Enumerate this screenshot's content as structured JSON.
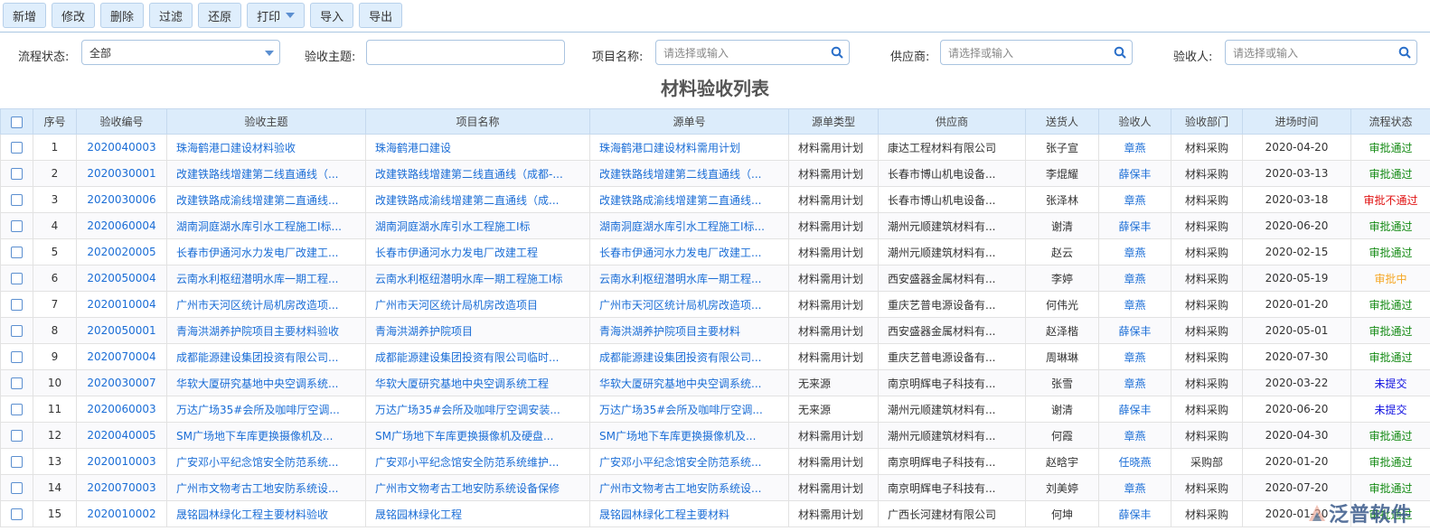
{
  "toolbar": {
    "buttons": [
      "新增",
      "修改",
      "删除",
      "过滤",
      "还原",
      "打印",
      "导入",
      "导出"
    ]
  },
  "filters": {
    "status_label": "流程状态:",
    "status_value": "全部",
    "subject_label": "验收主题:",
    "subject_value": "",
    "project_label": "项目名称:",
    "project_placeholder": "请选择或输入",
    "supplier_label": "供应商:",
    "supplier_placeholder": "请选择或输入",
    "receiver_label": "验收人:",
    "receiver_placeholder": "请选择或输入"
  },
  "page_title": "材料验收列表",
  "columns": [
    "序号",
    "验收编号",
    "验收主题",
    "项目名称",
    "源单号",
    "源单类型",
    "供应商",
    "送货人",
    "验收人",
    "验收部门",
    "进场时间",
    "流程状态"
  ],
  "status_colors": {
    "审批通过": "#138a13",
    "审批不通过": "#e01010",
    "审批中": "#f5a623",
    "未提交": "#1010e0"
  },
  "rows": [
    [
      "1",
      "2020040003",
      "珠海鹤港口建设材料验收",
      "珠海鹤港口建设",
      "珠海鹤港口建设材料需用计划",
      "材料需用计划",
      "康达工程材料有限公司",
      "张子宣",
      "章燕",
      "材料采购",
      "2020-04-20",
      "审批通过"
    ],
    [
      "2",
      "2020030001",
      "改建铁路线增建第二线直通线（...",
      "改建铁路线增建第二线直通线（成都-...",
      "改建铁路线增建第二线直通线（...",
      "材料需用计划",
      "长春市博山机电设备...",
      "李焜耀",
      "薛保丰",
      "材料采购",
      "2020-03-13",
      "审批通过"
    ],
    [
      "3",
      "2020030006",
      "改建铁路成渝线增建第二直通线...",
      "改建铁路成渝线增建第二直通线（成...",
      "改建铁路成渝线增建第二直通线...",
      "材料需用计划",
      "长春市博山机电设备...",
      "张泽林",
      "章燕",
      "材料采购",
      "2020-03-18",
      "审批不通过"
    ],
    [
      "4",
      "2020060004",
      "湖南洞庭湖水库引水工程施工I标...",
      "湖南洞庭湖水库引水工程施工I标",
      "湖南洞庭湖水库引水工程施工I标...",
      "材料需用计划",
      "潮州元顺建筑材料有...",
      "谢清",
      "薛保丰",
      "材料采购",
      "2020-06-20",
      "审批通过"
    ],
    [
      "5",
      "2020020005",
      "长春市伊通河水力发电厂改建工...",
      "长春市伊通河水力发电厂改建工程",
      "长春市伊通河水力发电厂改建工...",
      "材料需用计划",
      "潮州元顺建筑材料有...",
      "赵云",
      "章燕",
      "材料采购",
      "2020-02-15",
      "审批通过"
    ],
    [
      "6",
      "2020050004",
      "云南水利枢纽潜明水库一期工程...",
      "云南水利枢纽潜明水库一期工程施工I标",
      "云南水利枢纽潜明水库一期工程...",
      "材料需用计划",
      "西安盛器金属材料有...",
      "李婷",
      "章燕",
      "材料采购",
      "2020-05-19",
      "审批中"
    ],
    [
      "7",
      "2020010004",
      "广州市天河区统计局机房改造项...",
      "广州市天河区统计局机房改造项目",
      "广州市天河区统计局机房改造项...",
      "材料需用计划",
      "重庆艺普电源设备有...",
      "何伟光",
      "章燕",
      "材料采购",
      "2020-01-20",
      "审批通过"
    ],
    [
      "8",
      "2020050001",
      "青海洪湖养护院项目主要材料验收",
      "青海洪湖养护院项目",
      "青海洪湖养护院项目主要材料",
      "材料需用计划",
      "西安盛器金属材料有...",
      "赵泽楷",
      "薛保丰",
      "材料采购",
      "2020-05-01",
      "审批通过"
    ],
    [
      "9",
      "2020070004",
      "成都能源建设集团投资有限公司...",
      "成都能源建设集团投资有限公司临时...",
      "成都能源建设集团投资有限公司...",
      "材料需用计划",
      "重庆艺普电源设备有...",
      "周琳琳",
      "章燕",
      "材料采购",
      "2020-07-30",
      "审批通过"
    ],
    [
      "10",
      "2020030007",
      "华软大厦研究基地中央空调系统...",
      "华软大厦研究基地中央空调系统工程",
      "华软大厦研究基地中央空调系统...",
      "无来源",
      "南京明辉电子科技有...",
      "张雪",
      "章燕",
      "材料采购",
      "2020-03-22",
      "未提交"
    ],
    [
      "11",
      "2020060003",
      "万达广场35#会所及咖啡厅空调...",
      "万达广场35#会所及咖啡厅空调安装...",
      "万达广场35#会所及咖啡厅空调...",
      "无来源",
      "潮州元顺建筑材料有...",
      "谢清",
      "薛保丰",
      "材料采购",
      "2020-06-20",
      "未提交"
    ],
    [
      "12",
      "2020040005",
      "SM广场地下车库更换摄像机及...",
      "SM广场地下车库更换摄像机及硬盘...",
      "SM广场地下车库更换摄像机及...",
      "材料需用计划",
      "潮州元顺建筑材料有...",
      "何霞",
      "章燕",
      "材料采购",
      "2020-04-30",
      "审批通过"
    ],
    [
      "13",
      "2020010003",
      "广安邓小平纪念馆安全防范系统...",
      "广安邓小平纪念馆安全防范系统维护...",
      "广安邓小平纪念馆安全防范系统...",
      "材料需用计划",
      "南京明辉电子科技有...",
      "赵晗宇",
      "任晓燕",
      "采购部",
      "2020-01-20",
      "审批通过"
    ],
    [
      "14",
      "2020070003",
      "广州市文物考古工地安防系统设...",
      "广州市文物考古工地安防系统设备保修",
      "广州市文物考古工地安防系统设...",
      "材料需用计划",
      "南京明辉电子科技有...",
      "刘美婷",
      "章燕",
      "材料采购",
      "2020-07-20",
      "审批通过"
    ],
    [
      "15",
      "2020010002",
      "晟铭园林绿化工程主要材料验收",
      "晟铭园林绿化工程",
      "晟铭园林绿化工程主要材料",
      "材料需用计划",
      "广西长河建材有限公司",
      "何坤",
      "薛保丰",
      "材料采购",
      "2020-01-20",
      "审批通过"
    ]
  ],
  "watermark": "泛普软件"
}
